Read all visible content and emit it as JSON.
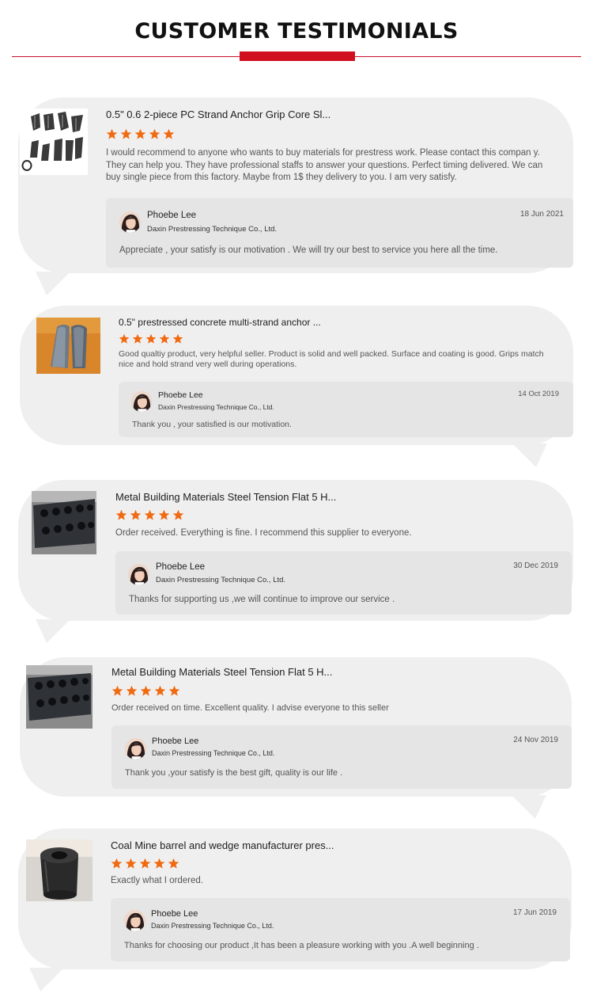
{
  "header": {
    "title": "CUSTOMER TESTIMONIALS"
  },
  "accent_colors": {
    "brand_red": "#d0101e",
    "star_orange": "#f06a12",
    "bubble_gray": "#efefef"
  },
  "testimonials": [
    {
      "product_image": "wedge-grip-cores-image",
      "product_title": "0.5\" 0.6 2-piece PC Strand Anchor Grip Core Sl...",
      "rating": 5,
      "review": "I would recommend to anyone who wants to buy materials for prestress work. Please contact this compan y. They can help you. They have professional staffs to answer your questions.  Perfect timing delivered. We can buy single piece from this factory. Maybe from 1$ they delivery to you. I am very satisfy.",
      "reply": {
        "name": "Phoebe Lee",
        "company": "Daxin Prestressing Technique Co., Ltd.",
        "date": "18 Jun 2021",
        "text": "Appreciate , your satisfy is our motivation . We will try our best to service you here all the time."
      }
    },
    {
      "product_image": "multi-strand-anchor-wedge-image",
      "product_title": "0.5\" prestressed concrete multi-strand anchor ...",
      "rating": 5,
      "review": "Good qualtiy product, very helpful seller. Product is solid and well packed. Surface and coating is good. Grips match nice and hold strand very well during operations.",
      "reply": {
        "name": "Phoebe Lee",
        "company": "Daxin Prestressing Technique Co., Ltd.",
        "date": "14 Oct 2019",
        "text": "Thank you , your satisfied is our motivation."
      }
    },
    {
      "product_image": "flat-anchor-block-image",
      "product_title": "Metal Building Materials Steel Tension Flat 5 H...",
      "rating": 5,
      "review": "Order received. Everything is fine. I recommend this supplier to everyone.",
      "reply": {
        "name": "Phoebe Lee",
        "company": "Daxin Prestressing Technique Co., Ltd.",
        "date": "30 Dec 2019",
        "text": "Thanks for supporting us ,we will continue to improve our service ."
      }
    },
    {
      "product_image": "flat-anchor-block-image",
      "product_title": "Metal Building Materials Steel Tension Flat 5 H...",
      "rating": 5,
      "review": "Order received on time. Excellent quality. I advise everyone to this seller",
      "reply": {
        "name": "Phoebe Lee",
        "company": "Daxin Prestressing Technique Co., Ltd.",
        "date": "24 Nov 2019",
        "text": "Thank you ,your satisfy is the best gift, quality is our life ."
      }
    },
    {
      "product_image": "barrel-anchor-image",
      "product_title": "Coal Mine barrel and wedge manufacturer pres...",
      "rating": 5,
      "review": "Exactly what I ordered.",
      "reply": {
        "name": "Phoebe Lee",
        "company": "Daxin Prestressing Technique Co., Ltd.",
        "date": "17 Jun 2019",
        "text": "Thanks for choosing our product ,It has been a pleasure working with you .A well beginning ."
      }
    }
  ]
}
